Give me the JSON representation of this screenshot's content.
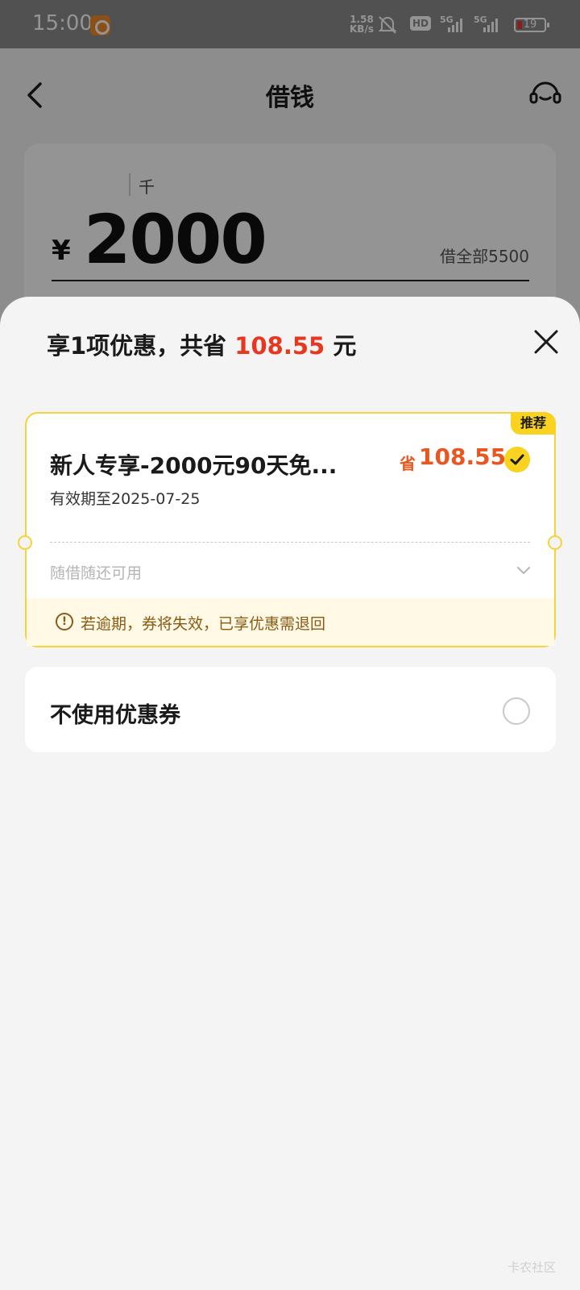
{
  "status_bar": {
    "time": "15:00",
    "net_speed_value": "1.58",
    "net_speed_unit": "KB/s",
    "hd_badge": "HD",
    "signal_1": "5G",
    "signal_2": "5G",
    "battery": "19"
  },
  "nav": {
    "title": "借钱",
    "back_icon": "chevron-left-icon",
    "service_icon": "headset-icon"
  },
  "amount_card": {
    "unit_label": "千",
    "currency": "¥",
    "amount": "2000",
    "borrow_all": "借全部5500"
  },
  "sheet": {
    "title_prefix": "享1项优惠，共省",
    "title_amount": "108.55",
    "title_suffix": "元",
    "close_icon": "close-icon"
  },
  "coupon": {
    "badge": "推荐",
    "name": "新人专享-2000元90天免...",
    "validity": "有效期至2025-07-25",
    "save_prefix": "省",
    "save_amount": "108.55",
    "selected": true,
    "usage": "随借随还可用",
    "warning": "若逾期，券将失效，已享优惠需退回"
  },
  "no_coupon": {
    "label": "不使用优惠券",
    "selected": false
  },
  "watermark": "卡农社区",
  "colors": {
    "accent_yellow": "#f9d31f",
    "saving_red": "#e9361f",
    "warning_brown": "#8a5a14"
  }
}
